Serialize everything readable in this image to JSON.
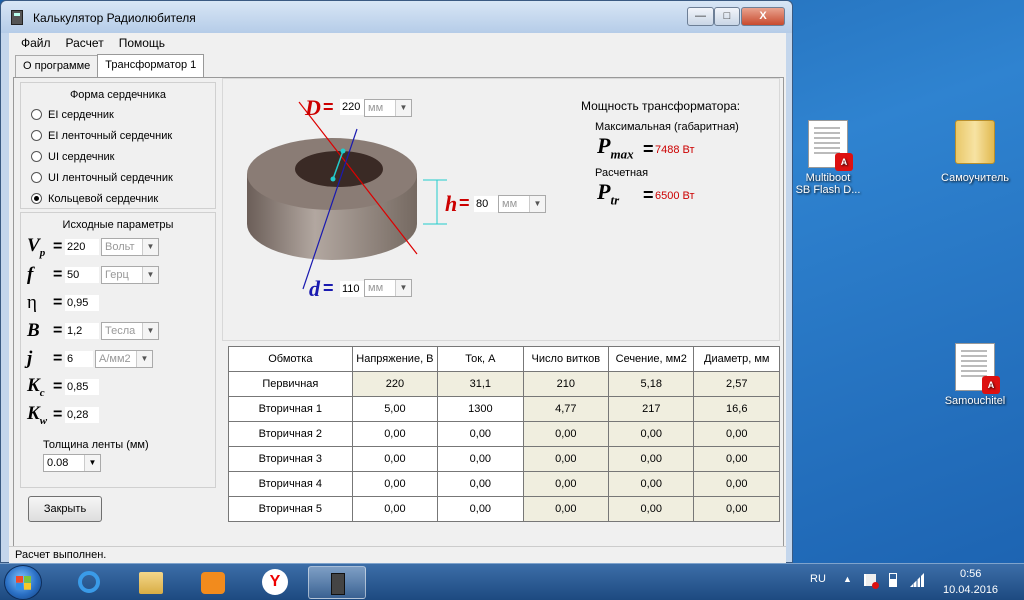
{
  "window": {
    "title": "Калькулятор Радиолюбителя",
    "controls": {
      "minimize": "—",
      "maximize": "□",
      "close": "X"
    }
  },
  "menu": [
    "Файл",
    "Расчет",
    "Помощь"
  ],
  "tabs": [
    "О программе",
    "Трансформатор 1"
  ],
  "core_shape": {
    "title": "Форма сердечника",
    "options": [
      "EI сердечник",
      "EI ленточный сердечник",
      "UI сердечник",
      "UI ленточный сердечник",
      "Кольцевой сердечник"
    ],
    "selected_index": 4
  },
  "input_params": {
    "title": "Исходные параметры",
    "rows": [
      {
        "sym": "V",
        "sub": "p",
        "value": "220",
        "unit": "Вольт"
      },
      {
        "sym": "f",
        "sub": "",
        "value": "50",
        "unit": "Герц"
      },
      {
        "sym": "η",
        "sub": "",
        "value": "0,95",
        "unit": ""
      },
      {
        "sym": "B",
        "sub": "",
        "value": "1,2",
        "unit": "Тесла"
      },
      {
        "sym": "j",
        "sub": "",
        "value": "6",
        "unit": "А/мм2"
      },
      {
        "sym": "K",
        "sub": "c",
        "value": "0,85",
        "unit": ""
      },
      {
        "sym": "K",
        "sub": "w",
        "value": "0,28",
        "unit": ""
      }
    ],
    "tape_label": "Толщина ленты (мм)",
    "tape_value": "0.08"
  },
  "close_button": "Закрыть",
  "dimensions": {
    "D": {
      "label": "D",
      "value": "220",
      "unit": "мм"
    },
    "h": {
      "label": "h",
      "value": "80",
      "unit": "мм"
    },
    "d": {
      "label": "d",
      "value": "110",
      "unit": "мм"
    },
    "eq": "="
  },
  "power": {
    "title": "Мощность трансформатора:",
    "max_label": "Максимальная (габаритная)",
    "max_sym": "P",
    "max_sub": "max",
    "max_value": "7488 Вт",
    "calc_label": "Расчетная",
    "calc_sym": "P",
    "calc_sub": "tr",
    "calc_value": "6500 Вт"
  },
  "table": {
    "headers": [
      "Обмотка",
      "Напряжение, В",
      "Ток, А",
      "Число витков",
      "Сечение, мм2",
      "Диаметр, мм"
    ],
    "rows": [
      [
        "Первичная",
        "220",
        "31,1",
        "210",
        "5,18",
        "2,57"
      ],
      [
        "Вторичная 1",
        "5,00",
        "1300",
        "4,77",
        "217",
        "16,6"
      ],
      [
        "Вторичная 2",
        "0,00",
        "0,00",
        "0,00",
        "0,00",
        "0,00"
      ],
      [
        "Вторичная 3",
        "0,00",
        "0,00",
        "0,00",
        "0,00",
        "0,00"
      ],
      [
        "Вторичная 4",
        "0,00",
        "0,00",
        "0,00",
        "0,00",
        "0,00"
      ],
      [
        "Вторичная 5",
        "0,00",
        "0,00",
        "0,00",
        "0,00",
        "0,00"
      ]
    ]
  },
  "status": "Расчет выполнен.",
  "desktop_icons": [
    {
      "label_line1": "Multiboot",
      "label_line2": "SB Flash D..."
    },
    {
      "label_line1": "Самоучитель",
      "label_line2": ""
    },
    {
      "label_line1": "Samouchitel",
      "label_line2": ""
    }
  ],
  "taskbar": {
    "lang": "RU",
    "time": "0:56",
    "date": "10.04.2016",
    "yandex_letter": "Y"
  },
  "colors": {
    "accent_red": "#cc0000",
    "dim_blue": "#1a1ab0",
    "output_cell": "#f0eedf"
  }
}
